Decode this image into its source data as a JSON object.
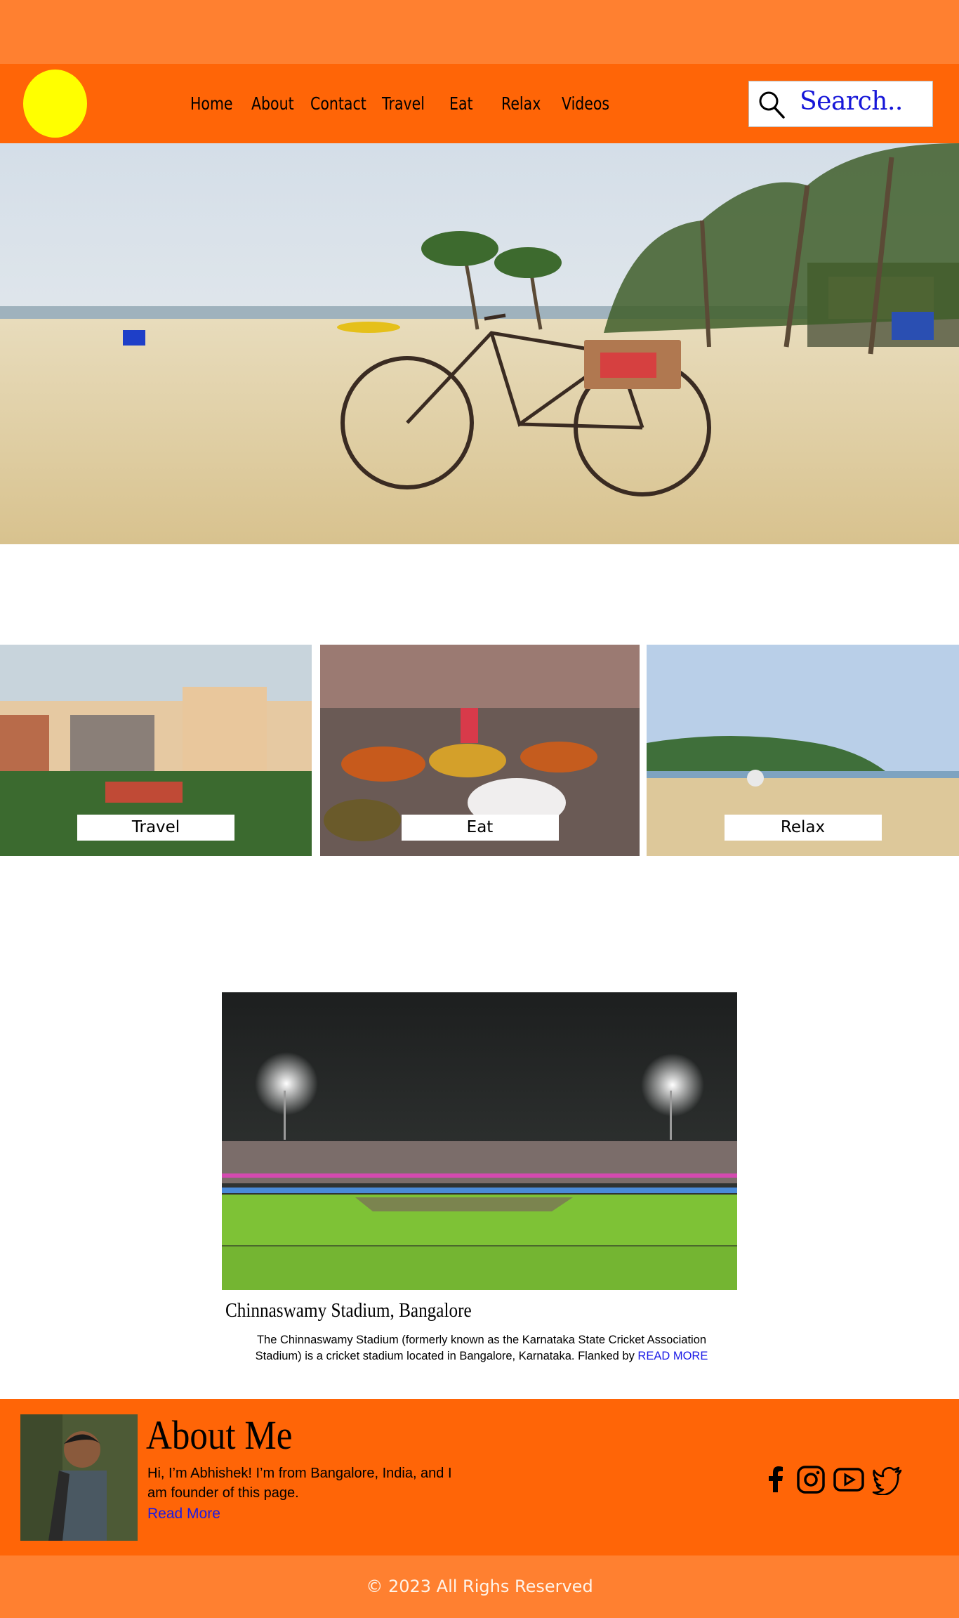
{
  "nav": {
    "items": [
      {
        "label": "Home"
      },
      {
        "label": "About"
      },
      {
        "label": "Contact"
      },
      {
        "label": "Travel"
      },
      {
        "label": "Eat"
      },
      {
        "label": "Relax"
      },
      {
        "label": "Videos"
      }
    ],
    "search_placeholder": "Search..",
    "logo_color": "#ffff00",
    "bar_color": "#ff6507",
    "strip_color": "#ff8030"
  },
  "hero": {
    "image": "beach-bicycle-photo"
  },
  "categories": [
    {
      "label": "Travel",
      "image": "temple-tank-photo"
    },
    {
      "label": "Eat",
      "image": "food-table-photo"
    },
    {
      "label": "Relax",
      "image": "beach-hills-photo"
    }
  ],
  "feature": {
    "image": "stadium-night-photo",
    "title": "Chinnaswamy Stadium, Bangalore",
    "description": "The Chinnaswamy Stadium (formerly known as the Karnataka State Cricket Association Stadium) is a cricket stadium located in Bangalore, Karnataka. Flanked by",
    "read_more": "READ MORE"
  },
  "about": {
    "title": "About Me",
    "text": "Hi, I’m Abhishek! I’m from Bangalore, India, and I am founder of this page.",
    "read_more": "Read More",
    "social": [
      "facebook-icon",
      "instagram-icon",
      "youtube-icon",
      "twitter-icon"
    ]
  },
  "footer": {
    "text": "© 2023 All Righs Reserved"
  }
}
